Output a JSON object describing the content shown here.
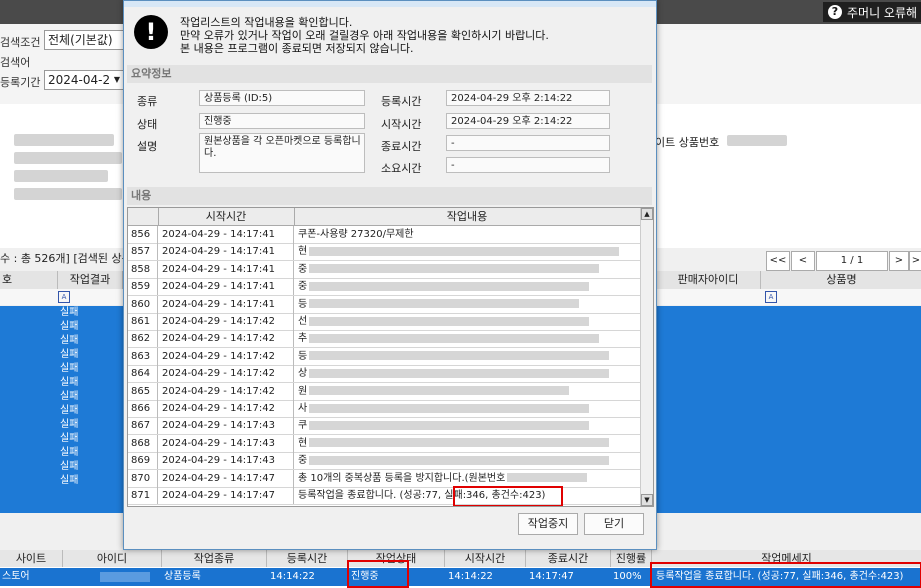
{
  "app": {
    "help_label": "주머니 오류해",
    "filter": {
      "condition_label": "검색조건",
      "condition_value": "전체(기본값)",
      "search_label": "검색어",
      "period_label": "등록기간",
      "period_value": "2024-04-2"
    },
    "side_hint": "이트 상품번호",
    "summary": "수 : 총 526개] [검색된 상품",
    "pager": {
      "first": "<<",
      "prev": "<",
      "page": "1 / 1",
      "next": ">",
      "last": ">"
    },
    "grid_headers": [
      "호",
      "작업결과",
      "판매자아이디",
      "상품명"
    ],
    "row_status": [
      "실패",
      "실패",
      "실패",
      "실패",
      "실패",
      "실패",
      "실패",
      "실패",
      "실패",
      "실패",
      "실패",
      "실패",
      "실패"
    ],
    "bottom": {
      "headers": [
        "사이트",
        "아이디",
        "작업종류",
        "등록시간",
        "작업상태",
        "시작시간",
        "종료시간",
        "진행률",
        "작업메세지"
      ],
      "row": {
        "site": "스토어",
        "kind": "상품등록",
        "reg_time": "14:14:22",
        "status": "진행중",
        "start": "14:14:22",
        "end": "14:17:47",
        "progress": "100%",
        "message": "등록작업을 종료합니다. (성공:77, 실패:346, 총건수:423)"
      }
    }
  },
  "dialog": {
    "messages": [
      "작업리스트의 작업내용을 확인합니다.",
      "만약 오류가 있거나 작업이 오래 걸릴경우 아래 작업내용을 확인하시기 바랍니다.",
      "본 내용은 프로그램이 종료되면 저장되지 않습니다."
    ],
    "summary_title": "요약정보",
    "fields": {
      "kind_label": "종류",
      "kind_value": "상품등록 (ID:5)",
      "status_label": "상태",
      "status_value": "진행중",
      "desc_label": "설명",
      "desc_value": "원본상품을 각 오픈마켓으로 등록합니다.",
      "reg_label": "등록시간",
      "reg_value": "2024-04-29 오후 2:14:22",
      "start_label": "시작시간",
      "start_value": "2024-04-29 오후 2:14:22",
      "end_label": "종료시간",
      "end_value": "-",
      "elapsed_label": "소요시간",
      "elapsed_value": "-"
    },
    "content_title": "내용",
    "log_headers": [
      "시작시간",
      "작업내용"
    ],
    "log_rows": [
      {
        "no": "856",
        "time": "2024-04-29  -  14:17:41",
        "msg": "쿠폰-사용량 27320/무제한"
      },
      {
        "no": "857",
        "time": "2024-04-29  -  14:17:41",
        "msg": "현"
      },
      {
        "no": "858",
        "time": "2024-04-29  -  14:17:41",
        "msg": "중"
      },
      {
        "no": "859",
        "time": "2024-04-29  -  14:17:41",
        "msg": "중"
      },
      {
        "no": "860",
        "time": "2024-04-29  -  14:17:41",
        "msg": "등"
      },
      {
        "no": "861",
        "time": "2024-04-29  -  14:17:42",
        "msg": "선"
      },
      {
        "no": "862",
        "time": "2024-04-29  -  14:17:42",
        "msg": "추"
      },
      {
        "no": "863",
        "time": "2024-04-29  -  14:17:42",
        "msg": "등"
      },
      {
        "no": "864",
        "time": "2024-04-29  -  14:17:42",
        "msg": "상"
      },
      {
        "no": "865",
        "time": "2024-04-29  -  14:17:42",
        "msg": "원"
      },
      {
        "no": "866",
        "time": "2024-04-29  -  14:17:42",
        "msg": "사"
      },
      {
        "no": "867",
        "time": "2024-04-29  -  14:17:43",
        "msg": "쿠"
      },
      {
        "no": "868",
        "time": "2024-04-29  -  14:17:43",
        "msg": "현"
      },
      {
        "no": "869",
        "time": "2024-04-29  -  14:17:43",
        "msg": "중"
      },
      {
        "no": "870",
        "time": "2024-04-29  -  14:17:47",
        "msg": "총 10개의 중복상품 등록을 방지합니다.(원본번호"
      },
      {
        "no": "871",
        "time": "2024-04-29  -  14:17:47",
        "msg": "등록작업을 종료합니다. (성공:77, 실패:346, 총건수:423)"
      }
    ],
    "stop_button": "작업중지",
    "close_button": "닫기"
  }
}
